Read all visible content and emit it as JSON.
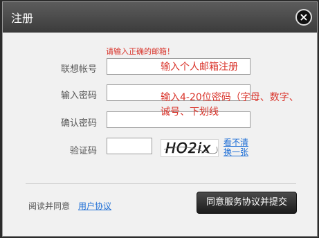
{
  "dialog": {
    "title": "注册",
    "close_symbol": "×"
  },
  "form": {
    "error_message": "请输入正确的邮箱！",
    "fields": [
      {
        "label": "联想帐号",
        "hint": "输入个人邮箱注册"
      },
      {
        "label": "输入密码",
        "hint_lines": [
          "输入4-20位密码（字母、数字、",
          "诚号、下划线"
        ]
      },
      {
        "label": "确认密码"
      },
      {
        "label": "验证码"
      }
    ],
    "captcha": {
      "text": "HO2ix",
      "refresh_lines": [
        "看不清",
        "换一张"
      ]
    }
  },
  "footer": {
    "agree_text": "阅读并同意",
    "agree_link": "用户协议",
    "submit_label": "同意服务协议并提交"
  },
  "colors": {
    "error": "#d9342b",
    "link": "#1f6fd6",
    "title_bar": "#4a4a4a"
  }
}
